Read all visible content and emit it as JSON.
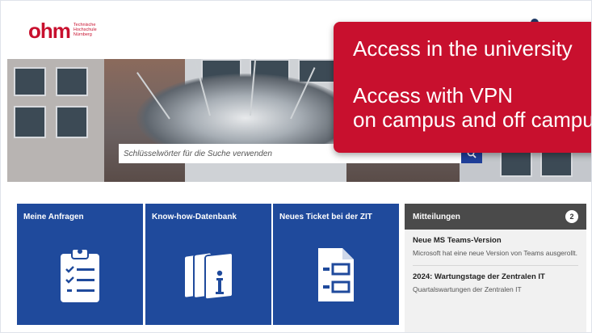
{
  "header": {
    "logo_word": "ohm",
    "logo_sub_line1": "Technische",
    "logo_sub_line2": "Hochschule",
    "logo_sub_line3": "Nürnberg"
  },
  "search": {
    "placeholder": "Schlüsselwörter für die Suche verwenden",
    "button_icon": "search-icon"
  },
  "overlay": {
    "line1": "Access in the university",
    "line2": "Access with VPN",
    "line3": "on campus and off campus",
    "color": "#c8102e"
  },
  "tiles": [
    {
      "title": "Meine Anfragen",
      "icon": "clipboard-checklist-icon"
    },
    {
      "title": "Know-how-Datenbank",
      "icon": "knowledge-books-icon"
    },
    {
      "title": "Neues Ticket bei der ZIT",
      "icon": "new-ticket-form-icon"
    }
  ],
  "messages": {
    "title": "Mitteilungen",
    "count": "2",
    "items": [
      {
        "title": "Neue MS Teams-Version",
        "body": "Microsoft hat eine neue Version von Teams ausgerollt."
      },
      {
        "title": "2024: Wartungstage der Zentralen IT",
        "body": "Quartalswartungen der Zentralen IT"
      }
    ]
  },
  "colors": {
    "brand_red": "#c8102e",
    "tile_blue": "#1f4a9c",
    "panel_header": "#4a4a4a"
  }
}
